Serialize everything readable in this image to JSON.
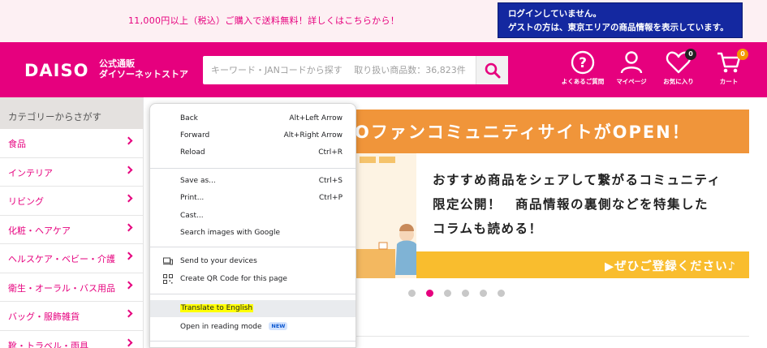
{
  "promo": {
    "text": "11,000円以上（税込）ご購入で送料無料！詳しくはこちらから！"
  },
  "login": {
    "line1": "ログインしていません。",
    "line2": "ゲストの方は、東京エリアの商品情報を表示しています。"
  },
  "header": {
    "logo": "DAISO",
    "logo_sub1": "公式通販",
    "logo_sub2": "ダイソーネットストア",
    "search_placeholder": "キーワード・JANコードから探す　 取り扱い商品数：36,823件",
    "faq_label": "よくあるご質問",
    "mypage_label": "マイページ",
    "favorites_label": "お気に入り",
    "favorites_count": "0",
    "cart_label": "カート",
    "cart_count": "0"
  },
  "sidebar": {
    "title": "カテゴリーからさがす",
    "items": [
      {
        "label": "食品"
      },
      {
        "label": "インテリア"
      },
      {
        "label": "リビング"
      },
      {
        "label": "化粧・ヘアケア"
      },
      {
        "label": "ヘルスケア・ベビー・介護"
      },
      {
        "label": "衛生・オーラル・バス用品"
      },
      {
        "label": "バッグ・服飾雑貨"
      },
      {
        "label": "靴・トラベル・雨具"
      }
    ]
  },
  "banner": {
    "title": "Oファンコミュニティサイトがオープン！",
    "title_display": "Oファンコミュニティサイトが",
    "title_open": "OPEN！",
    "text1": "おすすめ商品をシェアして繋がるコミュニティ",
    "text2": "限定公開！　商品情報の裏側などを特集した",
    "text3": "コラムも読める！",
    "cta": "▶ぜひご登録ください♪",
    "dots_total": 6,
    "dots_active": 2
  },
  "context_menu": {
    "back": "Back",
    "back_sc": "Alt+Left Arrow",
    "forward": "Forward",
    "forward_sc": "Alt+Right Arrow",
    "reload": "Reload",
    "reload_sc": "Ctrl+R",
    "save_as": "Save as...",
    "save_as_sc": "Ctrl+S",
    "print": "Print...",
    "print_sc": "Ctrl+P",
    "cast": "Cast...",
    "search_images": "Search images with Google",
    "send_devices": "Send to your devices",
    "qr_code": "Create QR Code for this page",
    "translate": "Translate to English",
    "reading_mode": "Open in reading mode",
    "new_badge": "NEW"
  },
  "colors": {
    "brand_pink": "#e6007e",
    "login_blue": "#1428a0",
    "banner_orange": "#f0953a",
    "cta_yellow": "#f9bd2e"
  }
}
